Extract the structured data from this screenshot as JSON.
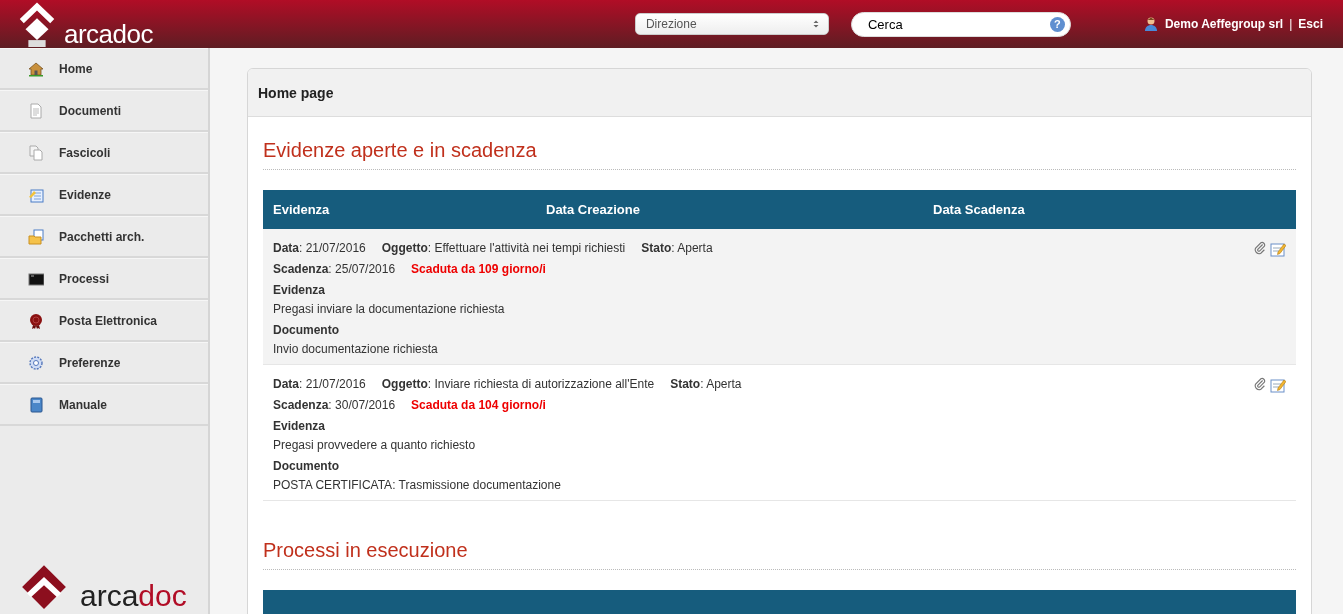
{
  "header": {
    "logo_text": "arcadoc",
    "office_select": {
      "value": "Direzione"
    },
    "search": {
      "placeholder": "Cerca",
      "help": "?"
    },
    "user": {
      "name": "Demo Aeffegroup srl",
      "separator": "|",
      "logout": "Esci"
    }
  },
  "sidebar": {
    "items": [
      {
        "label": "Home"
      },
      {
        "label": "Documenti"
      },
      {
        "label": "Fascicoli"
      },
      {
        "label": "Evidenze"
      },
      {
        "label": "Pacchetti arch."
      },
      {
        "label": "Processi"
      },
      {
        "label": "Posta Elettronica"
      },
      {
        "label": "Preferenze"
      },
      {
        "label": "Manuale"
      }
    ],
    "footer_logo": {
      "part_1": "arca",
      "part_2": "doc"
    }
  },
  "card": {
    "title": "Home page",
    "sections": [
      {
        "title": "Evidenze aperte e in scadenza",
        "columns": [
          "Evidenza",
          "Data Creazione",
          "Data Scadenza"
        ],
        "rows": [
          {
            "meta": [
              "**Data**: 21/07/2016",
              "**Oggetto**: Effettuare l'attività nei tempi richiesti",
              "**Stato**: Aperta"
            ],
            "due": "**Scadenza**: 25/07/2016",
            "overdue": "Scaduta da 109 giorno/i",
            "blocks": [
              {
                "label": "Evidenza",
                "text": "Pregasi inviare la documentazione richiesta"
              },
              {
                "label": "Documento",
                "text": "Invio documentazione richiesta"
              }
            ]
          },
          {
            "meta": [
              "**Data**: 21/07/2016",
              "**Oggetto**: Inviare richiesta di autorizzazione all'Ente",
              "**Stato**: Aperta"
            ],
            "due": "**Scadenza**: 30/07/2016",
            "overdue": "Scaduta da 104 giorno/i",
            "blocks": [
              {
                "label": "Evidenza",
                "text": "Pregasi provvedere a quanto richiesto"
              },
              {
                "label": "Documento",
                "text": "POSTA CERTIFICATA: Trasmissione documentazione"
              }
            ]
          }
        ]
      },
      {
        "title": "Processi in esecuzione"
      }
    ]
  }
}
